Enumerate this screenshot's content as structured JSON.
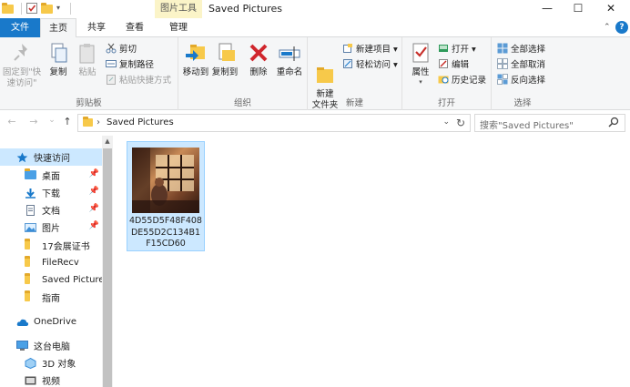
{
  "window": {
    "tool_header": "图片工具",
    "title": "Saved Pictures",
    "minimize_glyph": "—",
    "maximize_glyph": "☐",
    "close_glyph": "✕"
  },
  "tabs": [
    {
      "label": "文件"
    },
    {
      "label": "主页"
    },
    {
      "label": "共享"
    },
    {
      "label": "查看"
    },
    {
      "label": "管理"
    }
  ],
  "help_glyph": "?",
  "ribbon": {
    "clipboard": {
      "label": "剪贴板",
      "pin": "固定到\"快速访问\"",
      "copy": "复制",
      "paste": "粘贴",
      "cut": "剪切",
      "copy_path": "复制路径",
      "paste_shortcut": "粘贴快捷方式"
    },
    "organize": {
      "label": "组织",
      "move_to": "移动到",
      "copy_to": "复制到",
      "delete": "删除",
      "rename": "重命名"
    },
    "new": {
      "label": "新建",
      "new_folder": "新建\n文件夹",
      "new_item": "新建项目 ▾",
      "easy_access": "轻松访问 ▾"
    },
    "open": {
      "label": "打开",
      "properties": "属性",
      "open": "打开 ▾",
      "edit": "编辑",
      "history": "历史记录"
    },
    "select": {
      "label": "选择",
      "select_all": "全部选择",
      "select_none": "全部取消",
      "invert": "反向选择"
    }
  },
  "address": {
    "back": "←",
    "forward": "→",
    "recent": "⌄",
    "up": "↑",
    "crumb": "Saved Pictures",
    "separator": "›",
    "dropdown": "⌄",
    "refresh": "↻",
    "search_placeholder": "搜索\"Saved Pictures\""
  },
  "navpane": {
    "quick_access": "快速访问",
    "items": [
      {
        "label": "桌面",
        "pinned": true
      },
      {
        "label": "下载",
        "pinned": true
      },
      {
        "label": "文档",
        "pinned": true
      },
      {
        "label": "图片",
        "pinned": true
      },
      {
        "label": "17会展证书",
        "pinned": false
      },
      {
        "label": "FileRecv",
        "pinned": false
      },
      {
        "label": "Saved Pictures",
        "pinned": false
      },
      {
        "label": "指南",
        "pinned": false
      }
    ],
    "onedrive": "OneDrive",
    "this_pc": "这台电脑",
    "pc_items": [
      {
        "label": "3D 对象"
      },
      {
        "label": "视频"
      }
    ]
  },
  "files": [
    {
      "name": "4D55D5F48F408DE55D2C134B1F15CD60"
    }
  ],
  "colors": {
    "accent": "#1979ca",
    "selection": "#cce8ff",
    "tool_header": "#fbf4c8",
    "folder": "#f7c94a"
  }
}
